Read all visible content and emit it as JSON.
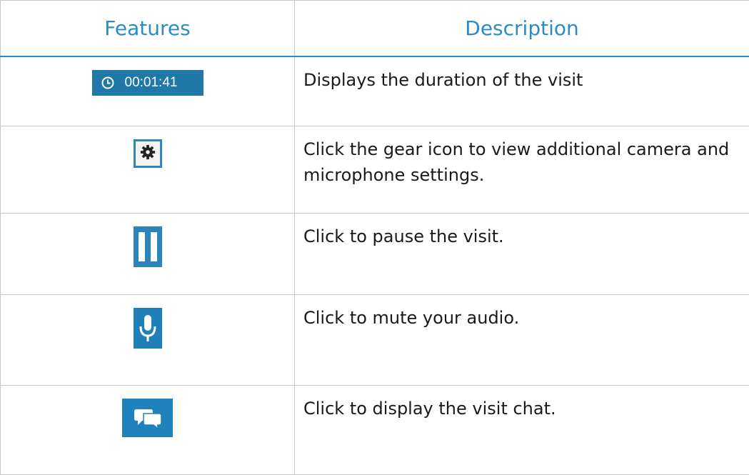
{
  "table": {
    "headers": {
      "features": "Features",
      "description": "Description"
    },
    "rows": [
      {
        "feature": {
          "kind": "timer",
          "icon": "clock-icon",
          "time": "00:01:41"
        },
        "description": "Displays the duration of the visit"
      },
      {
        "feature": {
          "kind": "button",
          "icon": "gear-icon"
        },
        "description": "Click the gear icon to view additional camera and microphone settings."
      },
      {
        "feature": {
          "kind": "button",
          "icon": "pause-icon"
        },
        "description": "Click to pause the visit."
      },
      {
        "feature": {
          "kind": "button",
          "icon": "microphone-icon"
        },
        "description": "Click to mute your audio."
      },
      {
        "feature": {
          "kind": "button",
          "icon": "chat-icon"
        },
        "description": "Click to display the visit chat."
      }
    ]
  },
  "colors": {
    "header_text": "#2b8cc4",
    "widget_blue": "#1f78a8",
    "border": "#c8c8c8"
  }
}
